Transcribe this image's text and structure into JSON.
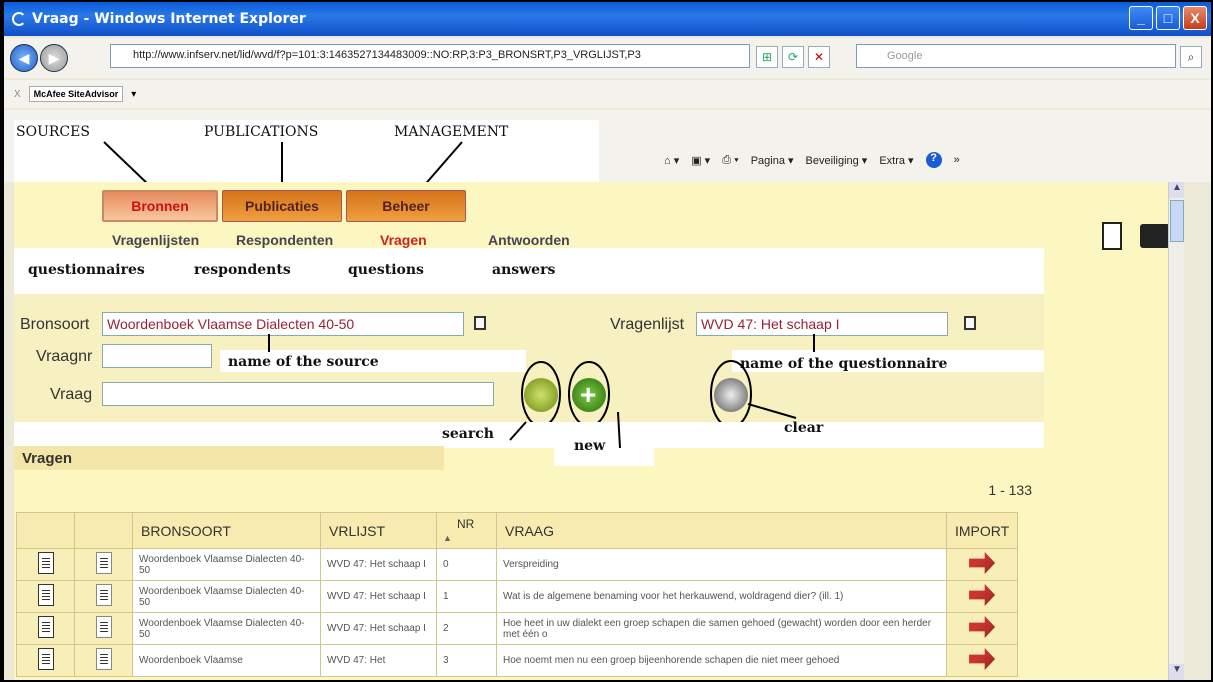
{
  "window": {
    "title": "Vraag - Windows Internet Explorer",
    "min": "_",
    "max": "□",
    "close": "X"
  },
  "address": {
    "url": "http://www.infserv.net/lid/wvd/f?p=101:3:1463527134483009::NO:RP,3:P3_BRONSRT,P3_VRGLIJST,P3",
    "search_placeholder": "Google"
  },
  "toolbar": {
    "mcafee": "McAfee SiteAdvisor",
    "close": "X"
  },
  "commandbar": {
    "pagina": "Pagina ▾",
    "beveiliging": "Beveiliging ▾",
    "extra": "Extra ▾",
    "help": "?",
    "more": "»"
  },
  "annotations": {
    "sources": "SOURCES",
    "publications": "PUBLICATIONS",
    "management": "MANAGEMENT",
    "questionnaires": "questionnaires",
    "respondents": "respondents",
    "questions": "questions",
    "answers": "answers",
    "name_source": "name of the source",
    "name_questionnaire": "name of the questionnaire",
    "search": "search",
    "new": "new",
    "clear": "clear"
  },
  "tabs": {
    "bronnen": "Bronnen",
    "publicaties": "Publicaties",
    "beheer": "Beheer"
  },
  "subnav": {
    "vragenlijsten": "Vragenlijsten",
    "respondenten": "Respondenten",
    "vragen": "Vragen",
    "antwoorden": "Antwoorden"
  },
  "form": {
    "bronsoort_label": "Bronsoort",
    "bronsoort_value": "Woordenboek Vlaamse Dialecten 40-50",
    "vragenlijst_label": "Vragenlijst",
    "vragenlijst_value": "WVD 47: Het schaap I",
    "vraagnr_label": "Vraagnr",
    "vraagnr_value": "",
    "vraag_label": "Vraag",
    "vraag_value": ""
  },
  "results": {
    "header": "Vragen",
    "count": "1 - 133",
    "columns": {
      "bronsoort": "BRONSOORT",
      "vrlijst": "VRLIJST",
      "nr": "NR",
      "vraag": "VRAAG",
      "import": "IMPORT"
    },
    "sort_indicator": "▲",
    "rows": [
      {
        "bronsoort": "Woordenboek Vlaamse Dialecten 40-50",
        "vrlijst": "WVD 47: Het schaap I",
        "nr": "0",
        "vraag": "Verspreiding"
      },
      {
        "bronsoort": "Woordenboek Vlaamse Dialecten 40-50",
        "vrlijst": "WVD 47: Het schaap I",
        "nr": "1",
        "vraag": "Wat is de algemene benaming voor het herkauwend, woldragend dier? (ill. 1)"
      },
      {
        "bronsoort": "Woordenboek Vlaamse Dialecten 40-50",
        "vrlijst": "WVD 47: Het schaap I",
        "nr": "2",
        "vraag": "Hoe heet in uw dialekt een groep schapen die samen gehoed (gewacht) worden door een herder met één o"
      },
      {
        "bronsoort": "Woordenboek Vlaamse",
        "vrlijst": "WVD 47: Het",
        "nr": "3",
        "vraag": "Hoe noemt men nu een groep bijeenhorende schapen die niet meer gehoed"
      }
    ]
  }
}
